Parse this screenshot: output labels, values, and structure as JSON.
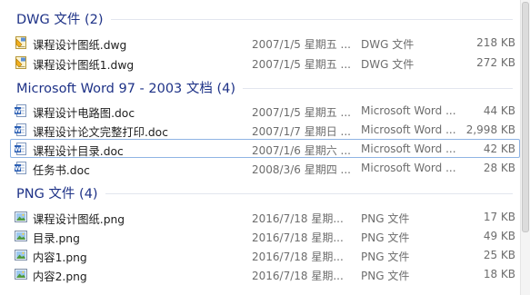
{
  "groups": [
    {
      "title": "DWG 文件 (2)",
      "files": [
        {
          "name": "课程设计图纸.dwg",
          "date": "2007/1/5 星期五 ...",
          "type": "DWG 文件",
          "size": "218 KB",
          "icon": "dwg-file-icon"
        },
        {
          "name": "课程设计图纸1.dwg",
          "date": "2007/1/5 星期五 ...",
          "type": "DWG 文件",
          "size": "272 KB",
          "icon": "dwg-file-icon"
        }
      ]
    },
    {
      "title": "Microsoft Word 97 - 2003 文档 (4)",
      "files": [
        {
          "name": "课程设计电路图.doc",
          "date": "2007/1/5 星期五 ...",
          "type": "Microsoft Word ...",
          "size": "44 KB",
          "icon": "word-doc-icon"
        },
        {
          "name": "课程设计论文完整打印.doc",
          "date": "2007/1/7 星期日 ...",
          "type": "Microsoft Word ...",
          "size": "2,998 KB",
          "icon": "word-doc-icon"
        },
        {
          "name": "课程设计目录.doc",
          "date": "2007/1/6 星期六 ...",
          "type": "Microsoft Word ...",
          "size": "42 KB",
          "icon": "word-doc-icon"
        },
        {
          "name": "任务书.doc",
          "date": "2008/3/6 星期四 ...",
          "type": "Microsoft Word ...",
          "size": "28 KB",
          "icon": "word-doc-icon"
        }
      ]
    },
    {
      "title": "PNG 文件 (4)",
      "files": [
        {
          "name": "课程设计图纸.png",
          "date": "2016/7/18 星期...",
          "type": "PNG 文件",
          "size": "17 KB",
          "icon": "png-image-icon"
        },
        {
          "name": "目录.png",
          "date": "2016/7/18 星期...",
          "type": "PNG 文件",
          "size": "49 KB",
          "icon": "png-image-icon"
        },
        {
          "name": "内容1.png",
          "date": "2016/7/18 星期...",
          "type": "PNG 文件",
          "size": "25 KB",
          "icon": "png-image-icon"
        },
        {
          "name": "内容2.png",
          "date": "2016/7/18 星期...",
          "type": "PNG 文件",
          "size": "18 KB",
          "icon": "png-image-icon"
        }
      ]
    }
  ],
  "focused_file": "课程设计目录.doc",
  "colors": {
    "group_title": "#1e3287",
    "focus_border": "#8fb4e4",
    "meta_text": "#6d6d6d"
  }
}
